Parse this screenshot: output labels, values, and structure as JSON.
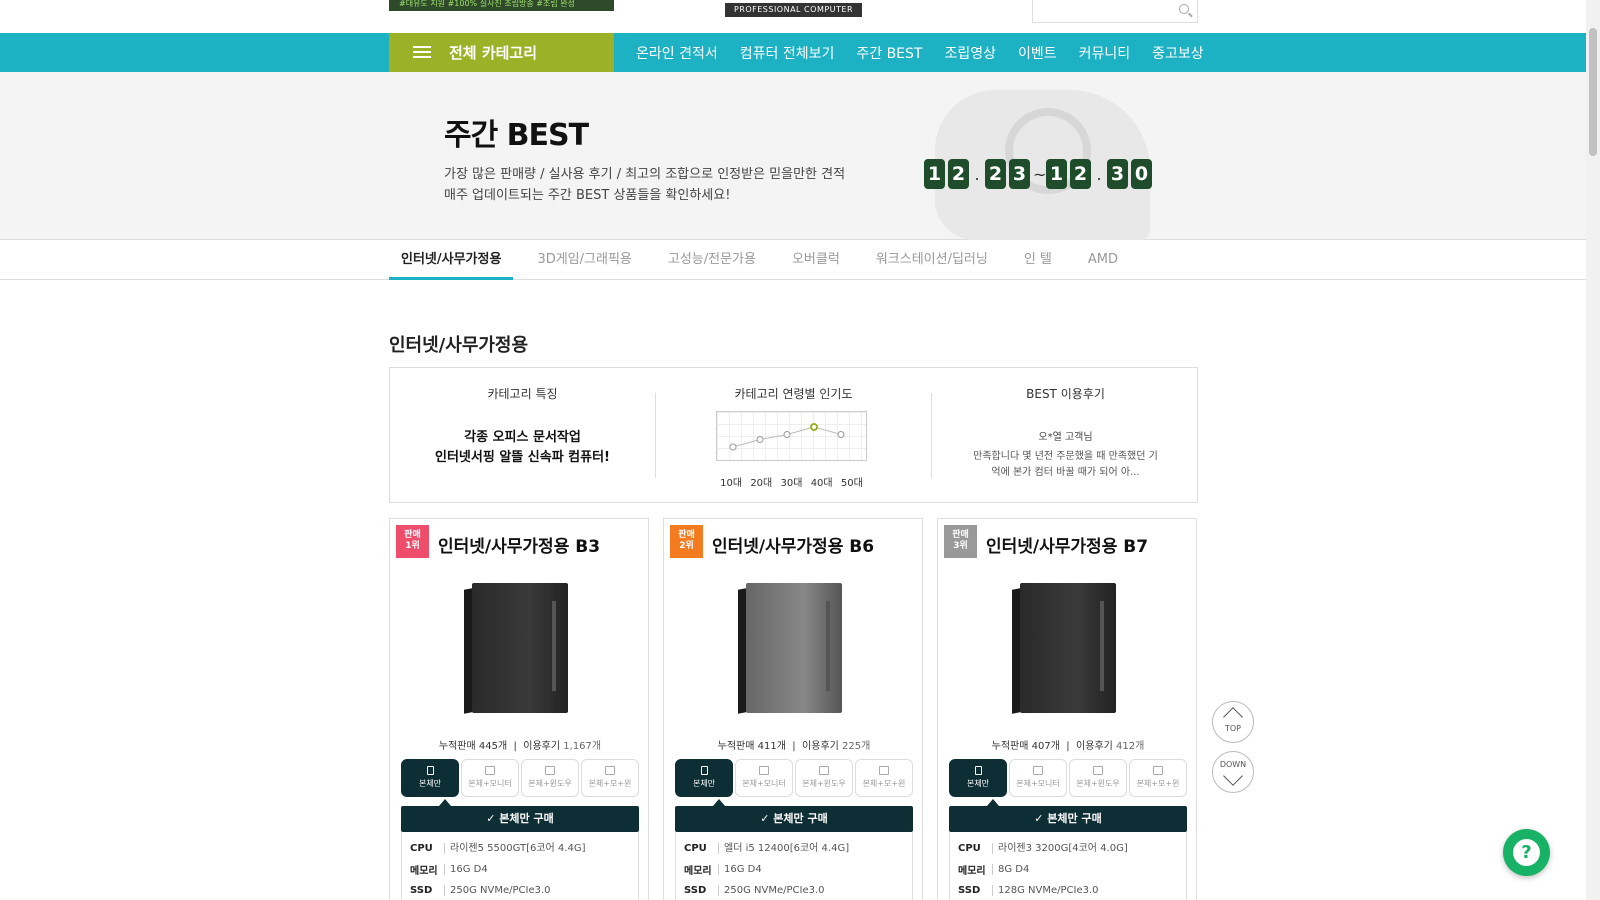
{
  "header": {
    "banner_text": "#대유도 지원 #100% 실사진 조립방송 #조립 완성",
    "logo_text": "PROFESSIONAL COMPUTER",
    "search_placeholder": ""
  },
  "nav": {
    "all_category": "전체 카테고리",
    "items": [
      "온라인 견적서",
      "컴퓨터 전체보기",
      "주간 BEST",
      "조립영상",
      "이벤트",
      "커뮤니티",
      "중고보상"
    ]
  },
  "hero": {
    "title": "주간 BEST",
    "desc_line1": "가장 많은 판매량 / 실사용 후기 / 최고의 조합으로 인정받은 믿을만한 견적",
    "desc_line2": "매주 업데이트되는 주간 BEST 상품들을 확인하세요!",
    "date_digits": [
      "1",
      "2",
      ".",
      "2",
      "3",
      "~",
      "1",
      "2",
      ".",
      "3",
      "0"
    ]
  },
  "tabs": [
    "인터넷/사무가정용",
    "3D게임/그래픽용",
    "고성능/전문가용",
    "오버클럭",
    "워크스테이션/딥러닝",
    "인 텔",
    "AMD"
  ],
  "section": {
    "title": "인터넷/사무가정용",
    "feature_heading": "카테고리 특징",
    "feature_line1": "각종 오피스 문서작업",
    "feature_line2": "인터넷서핑 알뜰 신속파 컴퓨터!",
    "age_heading": "카테고리 연령별 인기도",
    "ages": [
      "10대",
      "20대",
      "30대",
      "40대",
      "50대"
    ],
    "age_popularity": [
      30,
      45,
      55,
      70,
      55
    ],
    "review_heading": "BEST 이용후기",
    "reviewer": "오*열 고객님",
    "review_text": "만족합니다 몇 년전 주문했을 때 만족했던 기억에 본가 컴터 바꿀 때가 되어 아..."
  },
  "products": [
    {
      "rank_top": "판매",
      "rank": "1위",
      "badge_color": "#ee4d6b",
      "name": "인터넷/사무가정용 B3",
      "sales_label": "누적판매",
      "sales": "445개",
      "review_label": "이용후기",
      "reviews": "1,167개",
      "cpu": "라이젠5 5500GT[6코어 4.4G]",
      "mem": "16G D4",
      "ssd": "250G NVMe/PCIe3.0",
      "case": "black"
    },
    {
      "rank_top": "판매",
      "rank": "2위",
      "badge_color": "#f47b20",
      "name": "인터넷/사무가정용 B6",
      "sales_label": "누적판매",
      "sales": "411개",
      "review_label": "이용후기",
      "reviews": "225개",
      "cpu": "엘더 i5 12400[6코어 4.4G]",
      "mem": "16G D4",
      "ssd": "250G NVMe/PCIe3.0",
      "case": "silver"
    },
    {
      "rank_top": "판매",
      "rank": "3위",
      "badge_color": "#999999",
      "name": "인터넷/사무가정용 B7",
      "sales_label": "누적판매",
      "sales": "407개",
      "review_label": "이용후기",
      "reviews": "412개",
      "cpu": "라이젠3 3200G[4코어 4.0G]",
      "mem": "8G D4",
      "ssd": "128G NVMe/PCIe3.0",
      "case": "black"
    }
  ],
  "options": [
    "본체만",
    "본체+모니터",
    "본체+윈도우",
    "본체+모+윈"
  ],
  "buy_label": "✓ 본체만 구매",
  "spec_labels": {
    "cpu": "CPU",
    "mem": "메모리",
    "ssd": "SSD"
  },
  "float": {
    "top": "TOP",
    "down": "DOWN",
    "help": "?"
  }
}
